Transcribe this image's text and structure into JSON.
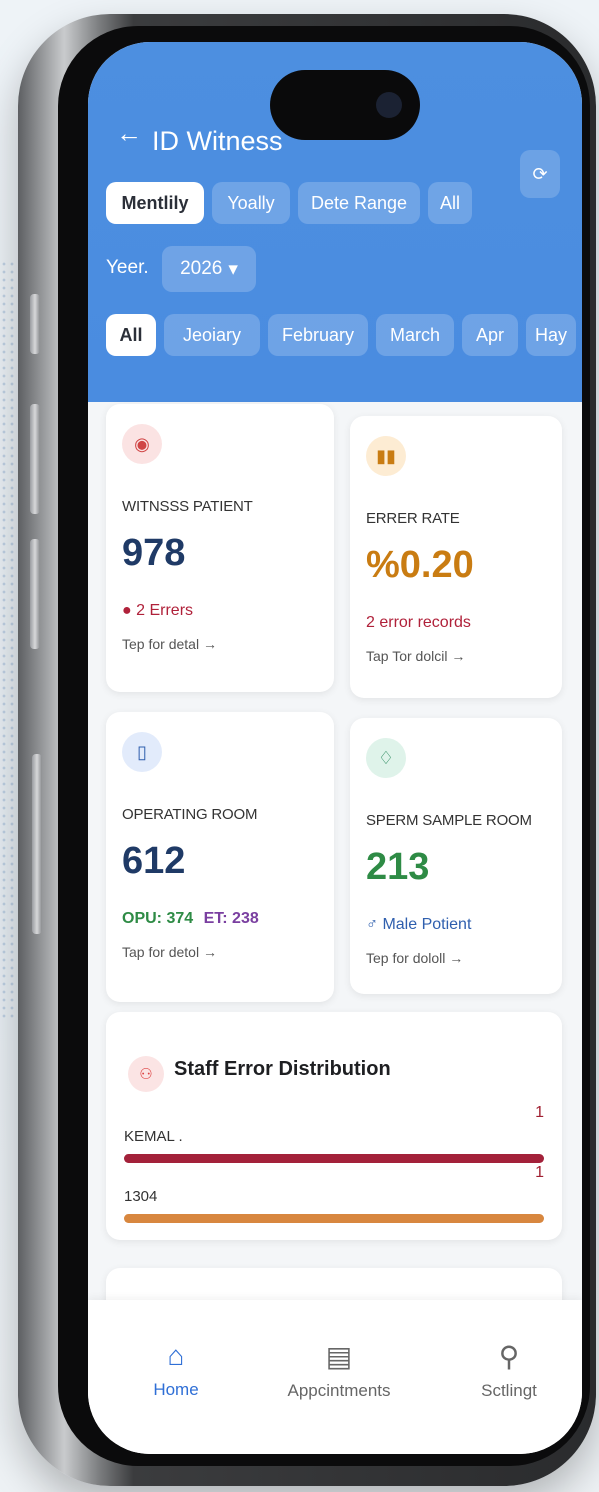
{
  "header": {
    "back_icon": "arrow-left-icon",
    "title": "ID Witness",
    "refresh_icon": "refresh-icon",
    "period_tabs": [
      "Mentlily",
      "Yoally",
      "Dete Range",
      "All"
    ],
    "year_label": "Yeer.",
    "year_value": "2026",
    "months": [
      "All",
      "Jeoiary",
      "February",
      "March",
      "Apr",
      "Hay"
    ]
  },
  "cards": {
    "witness": {
      "icon": "shield-icon",
      "label": "WITNSSS PATIENT",
      "value": "978",
      "sub": "2 Errers",
      "tap": "Tep for detal",
      "color": "#1f3a66"
    },
    "error_rate": {
      "icon": "chart-icon",
      "label": "ERRER RATE",
      "value": "%0.20",
      "sub": "2 error records",
      "tap": "Tap Tor dolcil",
      "color": "#c97c12"
    },
    "operating": {
      "icon": "door-icon",
      "label": "OPERATING ROOM",
      "value": "612",
      "opu": "OPU: 374",
      "et": "ET: 238",
      "tap": "Tap for detol",
      "color": "#1f3a66"
    },
    "sperm": {
      "icon": "drop-icon",
      "label": "SPERM SAMPLE ROOM",
      "value": "213",
      "sub": "Male Potient",
      "tap": "Tep for dololl",
      "color": "#2e8b45"
    }
  },
  "staff": {
    "icon": "people-icon",
    "title": "Staff Error Distribution",
    "rows": [
      {
        "name": "KEMAL .",
        "count": "1",
        "fraction": 1.0,
        "color": "#a3213a"
      },
      {
        "name": "1304",
        "count": "1",
        "fraction": 1.0,
        "color": "#d8873f"
      }
    ]
  },
  "tabbar": {
    "items": [
      {
        "label": "Home",
        "icon": "home-icon"
      },
      {
        "label": "Appcintments",
        "icon": "clipboard-icon"
      },
      {
        "label": "Sctlingt",
        "icon": "user-icon"
      }
    ]
  }
}
